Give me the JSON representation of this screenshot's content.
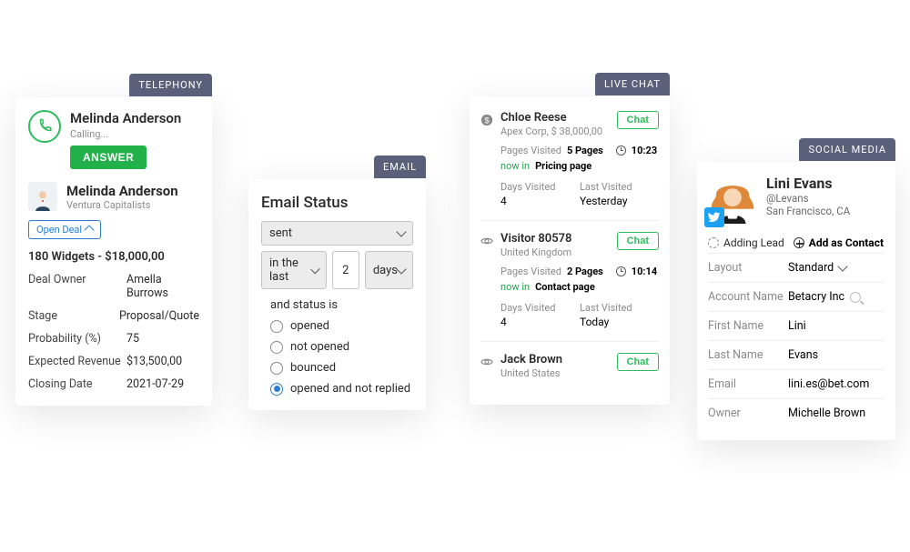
{
  "telephony": {
    "tag": "TELEPHONY",
    "caller_name": "Melinda Anderson",
    "status": "Calling...",
    "answer_label": "ANSWER",
    "contact_name": "Melinda Anderson",
    "contact_company": "Ventura Capitalists",
    "open_deal_label": "Open Deal",
    "deal_line": "180 Widgets - $18,000,00",
    "fields": [
      {
        "k": "Deal Owner",
        "v": "Amella Burrows"
      },
      {
        "k": "Stage",
        "v": "Proposal/Quote"
      },
      {
        "k": "Probability (%)",
        "v": "75"
      },
      {
        "k": "Expected Revenue",
        "v": "$13,500,00"
      },
      {
        "k": "Closing Date",
        "v": "2021-07-29"
      }
    ]
  },
  "email": {
    "tag": "EMAIL",
    "title": "Email Status",
    "status_select": "sent",
    "range_select": "in the last",
    "range_count": "2",
    "range_unit": "days",
    "and_line": "and status is",
    "options": [
      "opened",
      "not opened",
      "bounced",
      "opened and not replied"
    ],
    "selected_index": 3
  },
  "livechat": {
    "tag": "LIVE CHAT",
    "chat_label": "Chat",
    "pages_visited_label": "Pages Visited",
    "now_in_label": "now in",
    "days_visited_label": "Days Visited",
    "last_visited_label": "Last Visited",
    "visitors": [
      {
        "icon": "dollar",
        "name": "Chloe Reese",
        "sub": "Apex Corp, $ 38,000,00",
        "pages": "5 Pages",
        "time": "10:23",
        "now_page": "Pricing page",
        "days": "4",
        "last": "Yesterday",
        "full": true
      },
      {
        "icon": "eye",
        "name": "Visitor 80578",
        "sub": "United Kingdom",
        "pages": "2 Pages",
        "time": "10:14",
        "now_page": "Contact page",
        "days": "4",
        "last": "Today",
        "full": true
      },
      {
        "icon": "eye",
        "name": "Jack Brown",
        "sub": "United States",
        "full": false
      }
    ]
  },
  "social": {
    "tag": "SOCIAL MEDIA",
    "name": "Lini Evans",
    "handle": "@Levans",
    "location": "San Francisco, CA",
    "adding_lead": "Adding Lead",
    "add_contact": "Add as Contact",
    "fields": [
      {
        "k": "Layout",
        "v": "Standard",
        "dd": true
      },
      {
        "k": "Account Name",
        "v": "Betacry Inc",
        "search": true
      },
      {
        "k": "First Name",
        "v": "Lini"
      },
      {
        "k": "Last Name",
        "v": "Evans"
      },
      {
        "k": "Email",
        "v": "lini.es@bet.com"
      },
      {
        "k": "Owner",
        "v": "Michelle Brown"
      }
    ]
  }
}
